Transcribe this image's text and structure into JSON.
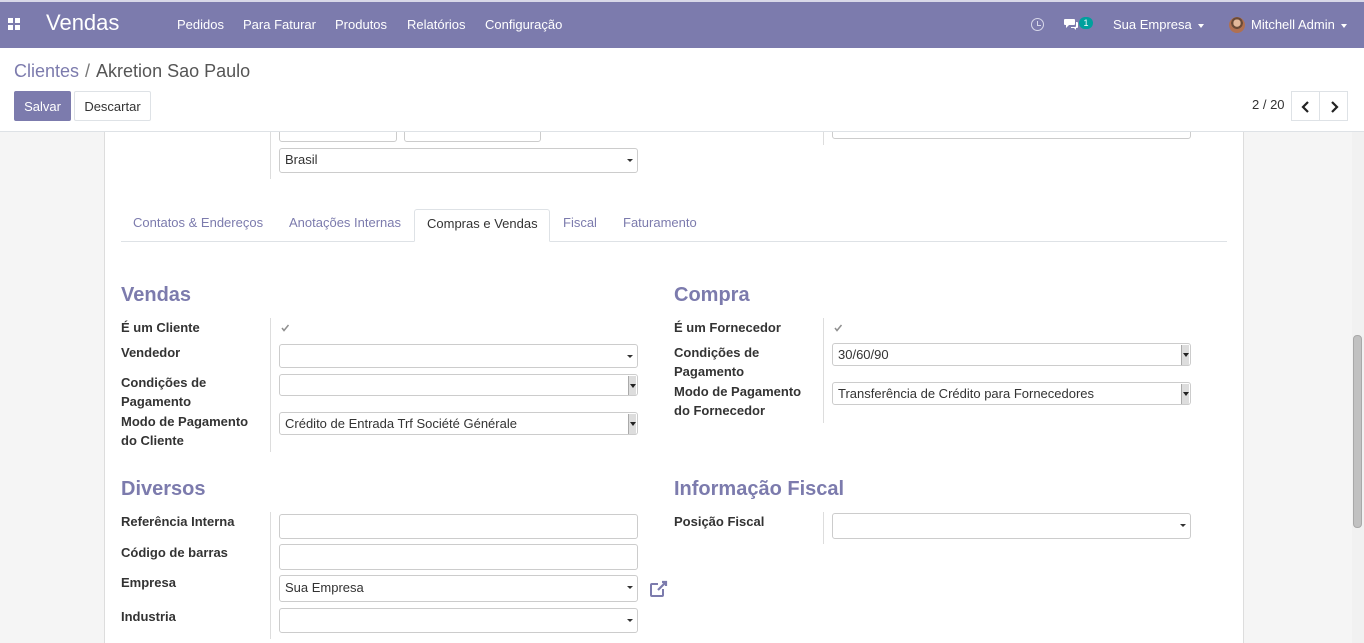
{
  "navbar": {
    "app_title": "Vendas",
    "menu": [
      "Pedidos",
      "Para Faturar",
      "Produtos",
      "Relatórios",
      "Configuração"
    ],
    "chat_badge": "1",
    "company": "Sua Empresa",
    "user": "Mitchell Admin",
    "color": "#7c7bad"
  },
  "control": {
    "breadcrumb_parent": "Clientes",
    "breadcrumb_separator": "/",
    "breadcrumb_current": "Akretion Sao Paulo",
    "save_label": "Salvar",
    "discard_label": "Descartar",
    "pager": "2 / 20"
  },
  "address": {
    "country": "Brasil"
  },
  "tabs": [
    "Contatos & Endereços",
    "Anotações Internas",
    "Compras e Vendas",
    "Fiscal",
    "Faturamento"
  ],
  "active_tab": "Compras e Vendas",
  "vendas": {
    "title": "Vendas",
    "is_customer_label": "É um Cliente",
    "is_customer": true,
    "salesperson_label": "Vendedor",
    "salesperson": "",
    "payment_terms_label_1": "Condições de",
    "payment_terms_label_2": "Pagamento",
    "payment_terms": "",
    "payment_mode_label_1": "Modo de Pagamento",
    "payment_mode_label_2": "do Cliente",
    "payment_mode": "Crédito de Entrada Trf Société Générale"
  },
  "compra": {
    "title": "Compra",
    "is_supplier_label": "É um Fornecedor",
    "is_supplier": true,
    "payment_terms_label_1": "Condições de",
    "payment_terms_label_2": "Pagamento",
    "payment_terms": "30/60/90",
    "payment_mode_label_1": "Modo de Pagamento",
    "payment_mode_label_2": "do Fornecedor",
    "payment_mode": "Transferência de Crédito para Fornecedores"
  },
  "diversos": {
    "title": "Diversos",
    "ref_label": "Referência Interna",
    "ref": "",
    "barcode_label": "Código de barras",
    "barcode": "",
    "company_label": "Empresa",
    "company": "Sua Empresa",
    "industry_label": "Industria",
    "industry": ""
  },
  "fiscal": {
    "title": "Informação Fiscal",
    "position_label": "Posição Fiscal",
    "position": ""
  },
  "icons": [
    "apps-icon",
    "clock-icon",
    "chat-icon",
    "external-link-icon",
    "chevron-left-icon",
    "chevron-right-icon",
    "check-icon"
  ]
}
